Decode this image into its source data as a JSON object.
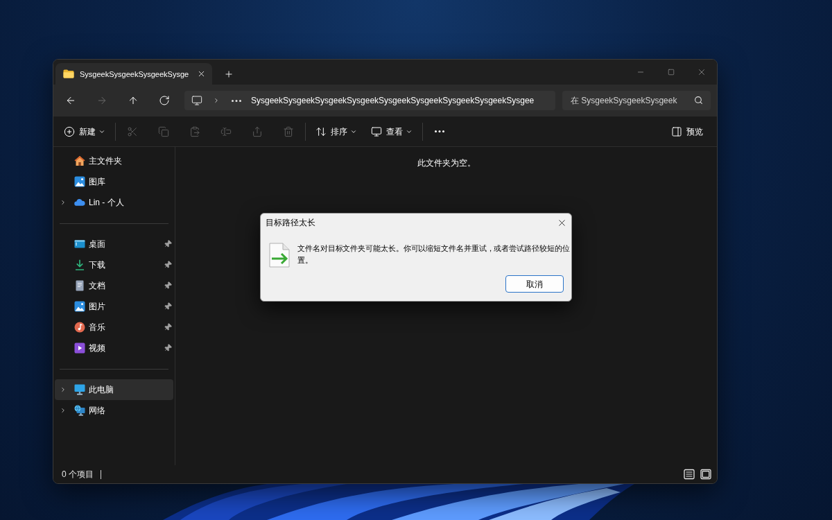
{
  "tabs": [
    {
      "title": "SysgeekSysgeekSysgeekSysge",
      "selected": true
    }
  ],
  "navigation": [
    {
      "kind": "back",
      "disabled": false
    },
    {
      "kind": "forward",
      "disabled": true
    },
    {
      "kind": "up",
      "disabled": false
    },
    {
      "kind": "refresh",
      "disabled": false
    }
  ],
  "address_bar": {
    "path": "SysgeekSysgeekSysgeekSysgeekSysgeekSysgeekSysgeekSysgeekSysgee"
  },
  "search": {
    "placeholder": "在 SysgeekSysgeekSysgeek"
  },
  "toolbar": {
    "groups": [
      {
        "items": [
          {
            "kind": "new",
            "label": "新建",
            "disabled": false
          }
        ]
      },
      {
        "items": [
          {
            "kind": "cut",
            "disabled": true
          },
          {
            "kind": "copy",
            "disabled": true
          },
          {
            "kind": "paste",
            "disabled": true
          },
          {
            "kind": "rename",
            "disabled": true
          },
          {
            "kind": "share",
            "disabled": true
          },
          {
            "kind": "delete",
            "disabled": true
          }
        ]
      },
      {
        "items": [
          {
            "kind": "sort",
            "label": "排序",
            "disabled": false
          },
          {
            "kind": "view",
            "label": "查看",
            "disabled": false
          }
        ]
      },
      {
        "items": [
          {
            "kind": "more",
            "disabled": false
          }
        ]
      }
    ],
    "preview": {
      "label": "预览"
    }
  },
  "sidebar": {
    "sections": [
      {
        "items": [
          {
            "kind": "home",
            "label": "主文件夹",
            "expandable": false,
            "pinned": false,
            "selected": false
          },
          {
            "kind": "gallery",
            "label": "图库",
            "expandable": false,
            "pinned": false,
            "selected": false
          },
          {
            "kind": "cloud",
            "label": "Lin - 个人",
            "expandable": true,
            "pinned": false,
            "selected": false
          }
        ]
      },
      {
        "items": [
          {
            "kind": "desktop",
            "label": "桌面",
            "expandable": false,
            "pinned": true,
            "selected": false
          },
          {
            "kind": "downloads",
            "label": "下载",
            "expandable": false,
            "pinned": true,
            "selected": false
          },
          {
            "kind": "documents",
            "label": "文档",
            "expandable": false,
            "pinned": true,
            "selected": false
          },
          {
            "kind": "pictures",
            "label": "图片",
            "expandable": false,
            "pinned": true,
            "selected": false
          },
          {
            "kind": "music",
            "label": "音乐",
            "expandable": false,
            "pinned": true,
            "selected": false
          },
          {
            "kind": "videos",
            "label": "视频",
            "expandable": false,
            "pinned": true,
            "selected": false
          }
        ]
      },
      {
        "items": [
          {
            "kind": "computer",
            "label": "此电脑",
            "expandable": true,
            "pinned": false,
            "selected": true
          },
          {
            "kind": "network",
            "label": "网络",
            "expandable": true,
            "pinned": false,
            "selected": false
          }
        ]
      }
    ]
  },
  "content": {
    "empty_message": "此文件夹为空。"
  },
  "status_bar": {
    "item_count": "0 个项目"
  },
  "dialog": {
    "title": "目标路径太长",
    "message": "文件名对目标文件夹可能太长。你可以缩短文件名并重试，或者尝试路径较短的位置。",
    "buttons": [
      {
        "label": "取消",
        "focused": true
      }
    ]
  }
}
